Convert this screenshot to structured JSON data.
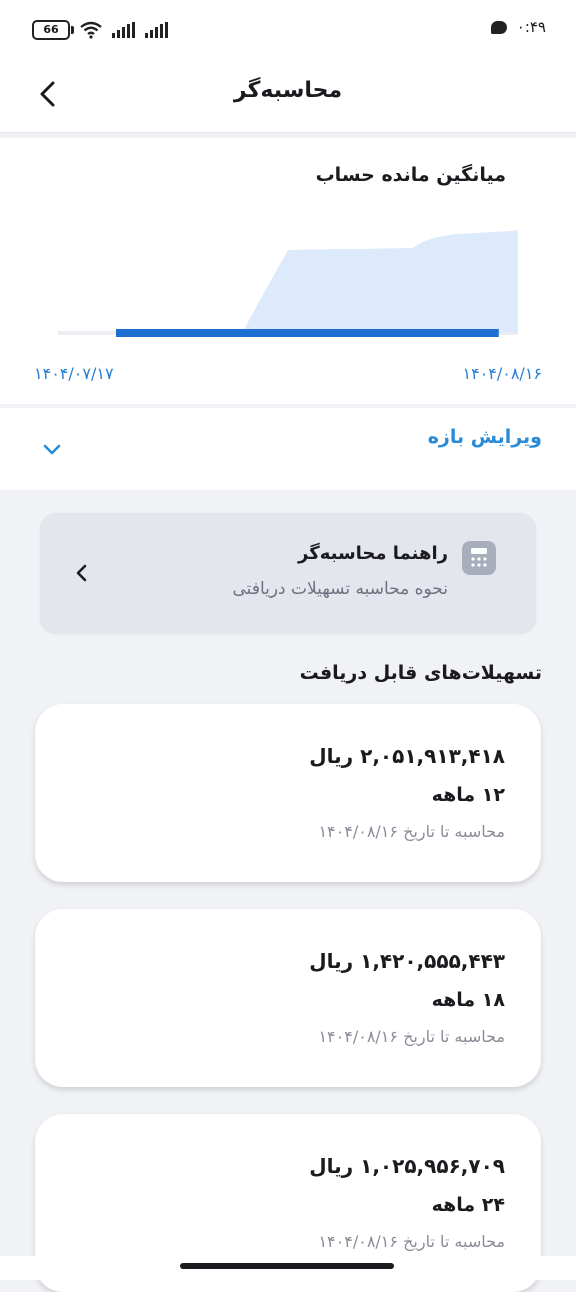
{
  "status_bar": {
    "battery": "66",
    "time": "۰:۴۹"
  },
  "header": {
    "title": "محاسبه‌گر"
  },
  "balance_chart": {
    "title": "میانگین مانده حساب",
    "start_date": "۱۴۰۴/۰۷/۱۷",
    "end_date": "۱۴۰۴/۰۸/۱۶",
    "chart_data": {
      "type": "area",
      "title": "میانگین مانده حساب",
      "x_start": "۱۴۰۴/۰۷/۱۷",
      "x_end": "۱۴۰۴/۰۸/۱۶",
      "x": [
        0,
        0.3,
        0.4,
        0.45,
        0.5,
        0.62,
        0.65,
        0.77,
        0.79,
        0.82,
        0.86,
        0.9,
        0.94,
        0.98,
        1.0
      ],
      "values": [
        0,
        0,
        0,
        0.4,
        0.79,
        0.8,
        0.8,
        0.81,
        0.86,
        0.91,
        0.94,
        0.95,
        0.96,
        0.97,
        0.98
      ],
      "highlight_range": [
        0.3,
        0.98
      ],
      "grid": false,
      "fill_color": "#dceafb",
      "highlight_color": "#1d6fd1"
    }
  },
  "range_editor": {
    "label": "ویرایش بازه"
  },
  "guide": {
    "title": "راهنما محاسبه‌گر",
    "subtitle": "نحوه محاسبه تسهیلات دریافتی"
  },
  "loans": {
    "section_title": "تسهیلات‌های قابل دریافت",
    "items": [
      {
        "amount": "۲,۰۵۱,۹۱۳,۴۱۸ ریال",
        "term": "۱۲ ماهه",
        "note": "محاسبه تا تاریخ ۱۴۰۴/۰۸/۱۶"
      },
      {
        "amount": "۱,۴۲۰,۵۵۵,۴۴۳ ریال",
        "term": "۱۸ ماهه",
        "note": "محاسبه تا تاریخ ۱۴۰۴/۰۸/۱۶"
      },
      {
        "amount": "۱,۰۲۵,۹۵۶,۷۰۹ ریال",
        "term": "۲۴ ماهه",
        "note": "محاسبه تا تاریخ ۱۴۰۴/۰۸/۱۶"
      }
    ]
  }
}
